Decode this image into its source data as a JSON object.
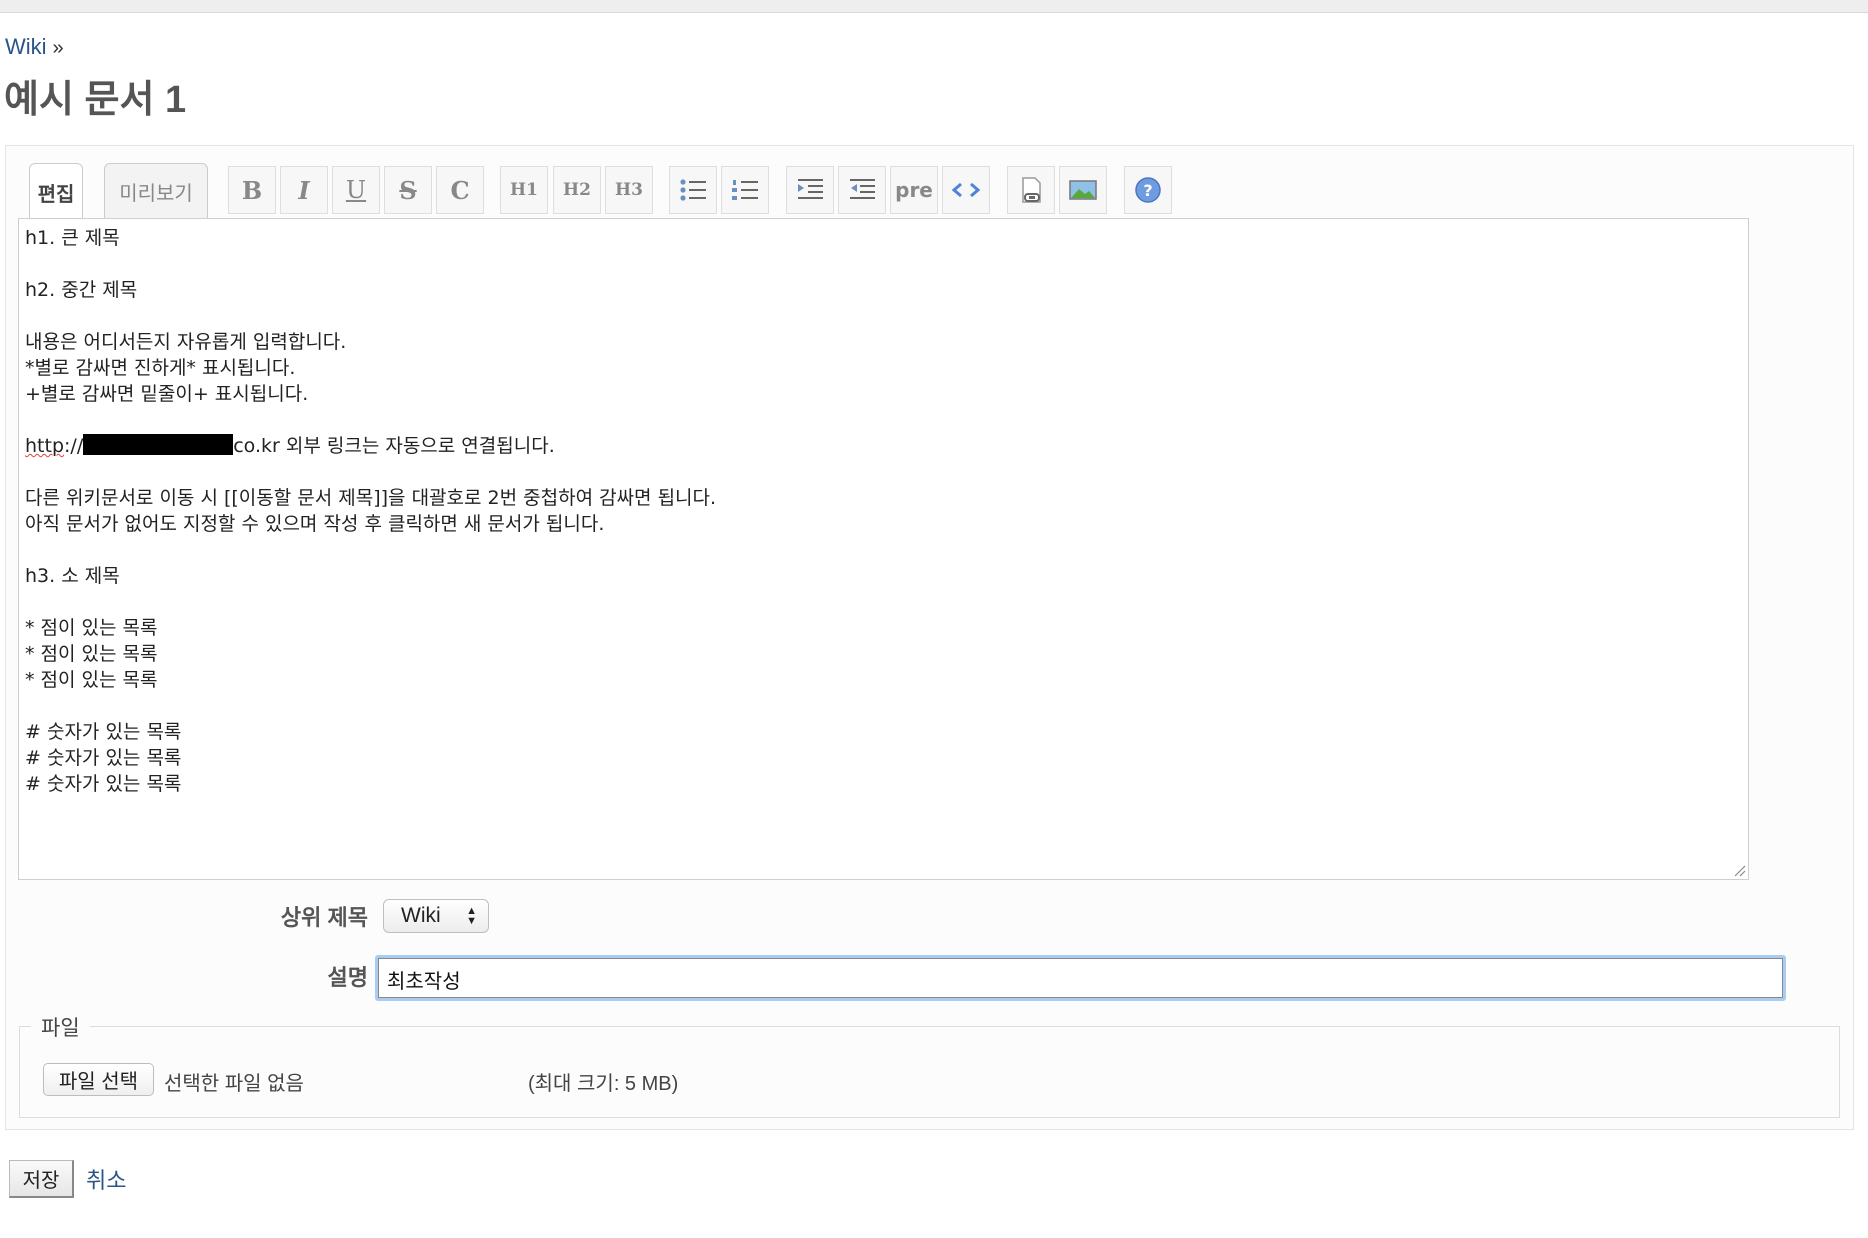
{
  "breadcrumb": {
    "link": "Wiki",
    "separator": "»"
  },
  "page_title": "예시 문서 1",
  "tabs": [
    {
      "label": "편집",
      "active": true
    },
    {
      "label": "미리보기",
      "active": false
    }
  ],
  "toolbar": {
    "bold": "B",
    "italic": "I",
    "underline": "U",
    "strike": "S",
    "code_inline": "C",
    "h1": "H1",
    "h2": "H2",
    "h3": "H3",
    "pre": "pre"
  },
  "editor": {
    "lines": [
      "h1. 큰 제목",
      "",
      "h2. 중간 제목",
      "",
      "내용은 어디서든지 자유롭게 입력합니다.",
      "*별로 감싸면 진하게* 표시됩니다.",
      "+별로 감싸면 밑줄이+ 표시됩니다.",
      "",
      "",
      "",
      "다른 위키문서로 이동 시 [[이동할 문서 제목]]을 대괄호로 2번 중첩하여 감싸면 됩니다.",
      "아직 문서가 없어도 지정할 수 있으며 작성 후 클릭하면 새 문서가 됩니다.",
      "",
      "h3. 소 제목",
      "",
      "* 점이 있는 목록",
      "* 점이 있는 목록",
      "* 점이 있는 목록",
      "",
      "# 숫자가 있는 목록",
      "# 숫자가 있는 목록",
      "# 숫자가 있는 목록"
    ],
    "link_line": {
      "prefix": "http",
      "middle": "://",
      "suffix": "co.kr 외부 링크는 자동으로 연결됩니다."
    }
  },
  "form": {
    "parent_label": "상위 제목",
    "parent_value": "Wiki",
    "description_label": "설명",
    "description_value": "최초작성"
  },
  "file": {
    "legend": "파일",
    "choose_button": "파일 선택",
    "no_file": "선택한 파일 없음",
    "max_size": "(최대 크기: 5 MB)"
  },
  "actions": {
    "save": "저장",
    "cancel": "취소"
  }
}
